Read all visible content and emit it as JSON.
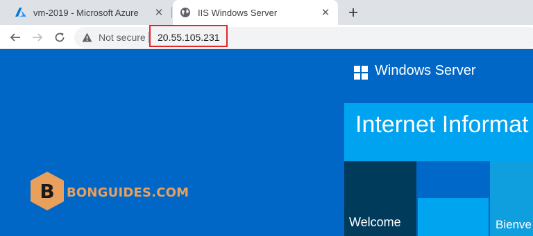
{
  "browser": {
    "tabs": [
      {
        "title": "vm-2019 - Microsoft Azure",
        "favicon": "azure-icon",
        "active": false
      },
      {
        "title": "IIS Windows Server",
        "favicon": "globe-icon",
        "active": true
      }
    ],
    "address_bar": {
      "security_label": "Not secure",
      "url": "20.55.105.231"
    }
  },
  "page": {
    "brand_title": "Windows Server",
    "tiles": {
      "iis_title": "Internet Informat",
      "welcome": "Welcome",
      "bienvenue": "Bienve"
    }
  },
  "watermark": {
    "logo_letter": "B",
    "text": "BONGUIDES.COM"
  },
  "colors": {
    "page_bg": "#0067c7",
    "tile_cyan": "#00a3ef",
    "tile_dark": "#003b5c",
    "highlight": "#e0262b",
    "watermark": "#e9a05c"
  }
}
